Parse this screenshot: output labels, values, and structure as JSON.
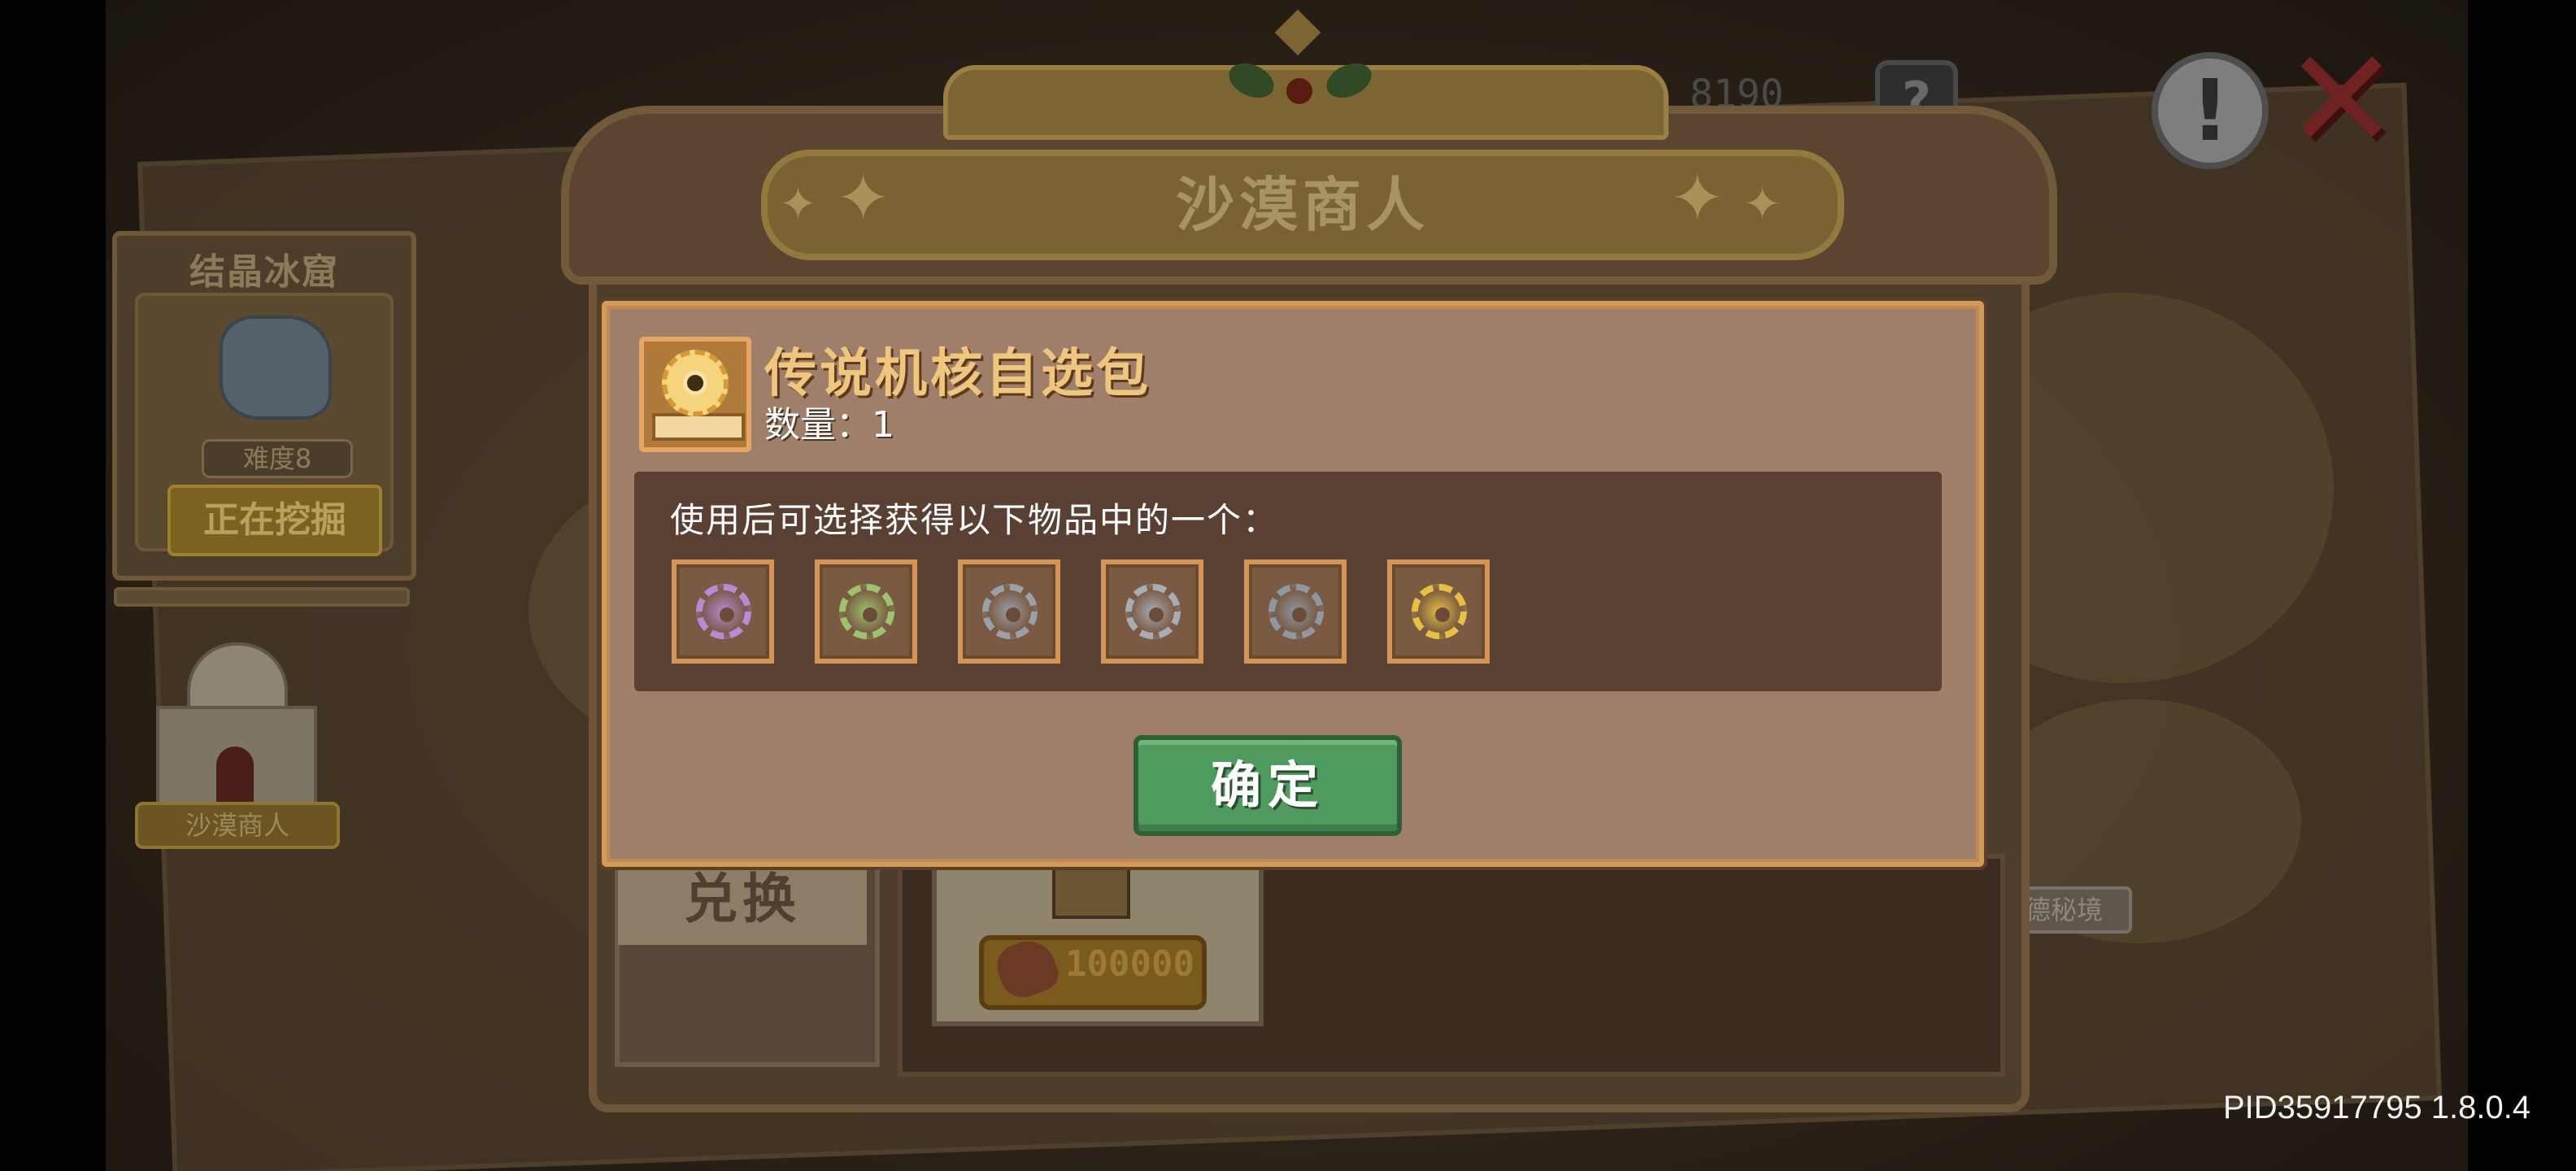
{
  "background": {
    "ice_cave": {
      "title": "结晶冰窟",
      "difficulty": "难度8",
      "action_label": "正在挖掘"
    },
    "desert_merchant_label": "沙漠商人",
    "secret_realm_label": "德秘境"
  },
  "hud": {
    "currency_count": "8190",
    "help_label": "?",
    "alert_label": "!",
    "close_label": "✕"
  },
  "merchant_window": {
    "title": "沙漠商人",
    "exchange_tab_label": "兑换",
    "shop_item_price": "100000"
  },
  "popup": {
    "item_name": "传说机核自选包",
    "quantity_label": "数量：1",
    "description": "使用后可选择获得以下物品中的一个：",
    "options": [
      {
        "icon": "purple-core-icon",
        "color": "#b88ad6"
      },
      {
        "icon": "green-core-icon",
        "color": "#9ac56b"
      },
      {
        "icon": "chain-core-icon",
        "color": "#9aa0a8"
      },
      {
        "icon": "gears-core-icon",
        "color": "#a7adb4"
      },
      {
        "icon": "steel-gear-core-icon",
        "color": "#8e98a3"
      },
      {
        "icon": "gold-gear-core-icon",
        "color": "#e8c040"
      }
    ],
    "confirm_label": "确定"
  },
  "version_info": "PID35917795 1.8.0.4"
}
